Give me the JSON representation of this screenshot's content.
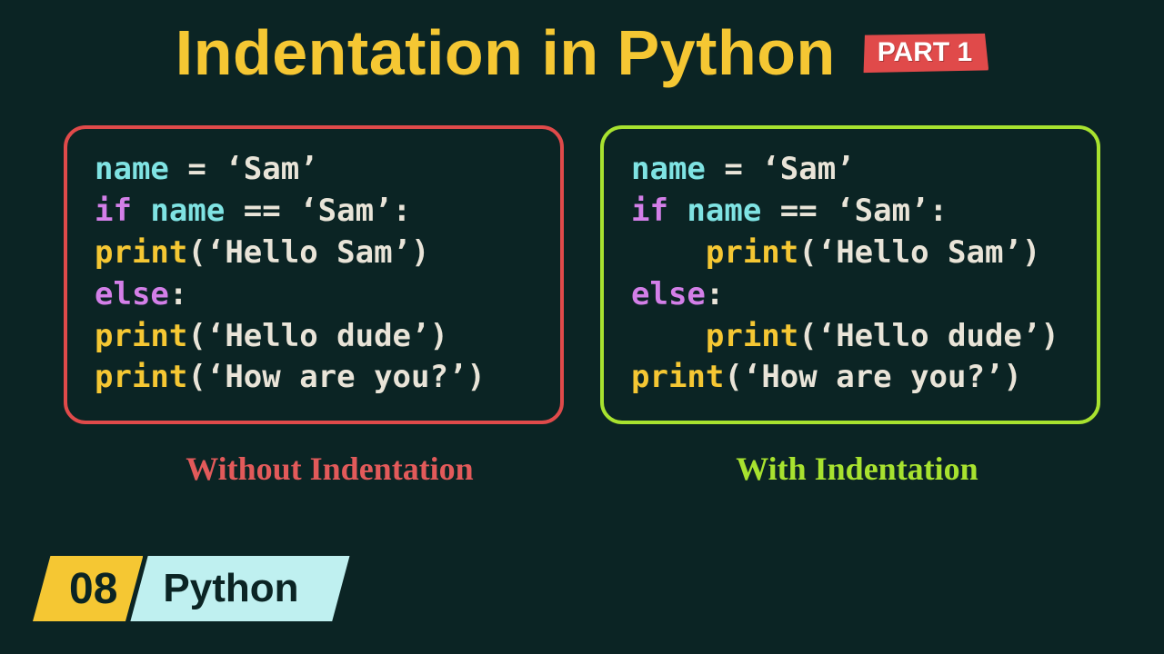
{
  "title": "Indentation in Python",
  "part_badge": "PART 1",
  "left": {
    "caption": "Without Indentation",
    "code": [
      [
        {
          "t": "name",
          "c": "var"
        },
        {
          "t": " = ",
          "c": "op"
        },
        {
          "t": "'Sam'",
          "c": "str"
        }
      ],
      [
        {
          "t": "if ",
          "c": "kw"
        },
        {
          "t": "name",
          "c": "var"
        },
        {
          "t": " == ",
          "c": "op"
        },
        {
          "t": "'Sam'",
          "c": "str"
        },
        {
          "t": ":",
          "c": "pun"
        }
      ],
      [
        {
          "t": "print",
          "c": "fn"
        },
        {
          "t": "(",
          "c": "pun"
        },
        {
          "t": "'Hello Sam'",
          "c": "str"
        },
        {
          "t": ")",
          "c": "pun"
        }
      ],
      [
        {
          "t": "else",
          "c": "kw"
        },
        {
          "t": ":",
          "c": "pun"
        }
      ],
      [
        {
          "t": "print",
          "c": "fn"
        },
        {
          "t": "(",
          "c": "pun"
        },
        {
          "t": "'Hello dude'",
          "c": "str"
        },
        {
          "t": ")",
          "c": "pun"
        }
      ],
      [
        {
          "t": "print",
          "c": "fn"
        },
        {
          "t": "(",
          "c": "pun"
        },
        {
          "t": "'How are you?'",
          "c": "str"
        },
        {
          "t": ")",
          "c": "pun"
        }
      ]
    ]
  },
  "right": {
    "caption": "With Indentation",
    "code": [
      [
        {
          "t": "name",
          "c": "var"
        },
        {
          "t": " = ",
          "c": "op"
        },
        {
          "t": "'Sam'",
          "c": "str"
        }
      ],
      [
        {
          "t": "if ",
          "c": "kw"
        },
        {
          "t": "name",
          "c": "var"
        },
        {
          "t": " == ",
          "c": "op"
        },
        {
          "t": "'Sam'",
          "c": "str"
        },
        {
          "t": ":",
          "c": "pun"
        }
      ],
      [
        {
          "t": "    ",
          "c": "op"
        },
        {
          "t": "print",
          "c": "fn"
        },
        {
          "t": "(",
          "c": "pun"
        },
        {
          "t": "'Hello Sam'",
          "c": "str"
        },
        {
          "t": ")",
          "c": "pun"
        }
      ],
      [
        {
          "t": "else",
          "c": "kw"
        },
        {
          "t": ":",
          "c": "pun"
        }
      ],
      [
        {
          "t": "    ",
          "c": "op"
        },
        {
          "t": "print",
          "c": "fn"
        },
        {
          "t": "(",
          "c": "pun"
        },
        {
          "t": "'Hello dude'",
          "c": "str"
        },
        {
          "t": ")",
          "c": "pun"
        }
      ],
      [
        {
          "t": "print",
          "c": "fn"
        },
        {
          "t": "(",
          "c": "pun"
        },
        {
          "t": "'How are you?'",
          "c": "str"
        },
        {
          "t": ")",
          "c": "pun"
        }
      ]
    ]
  },
  "footer": {
    "number": "08",
    "language": "Python"
  },
  "colors": {
    "bg": "#0b2424",
    "yellow": "#f5c733",
    "red": "#e04a4a",
    "green": "#a8e22f",
    "cyan": "#7fe3e3",
    "magenta": "#d37fe8",
    "text": "#e9e4d8"
  }
}
